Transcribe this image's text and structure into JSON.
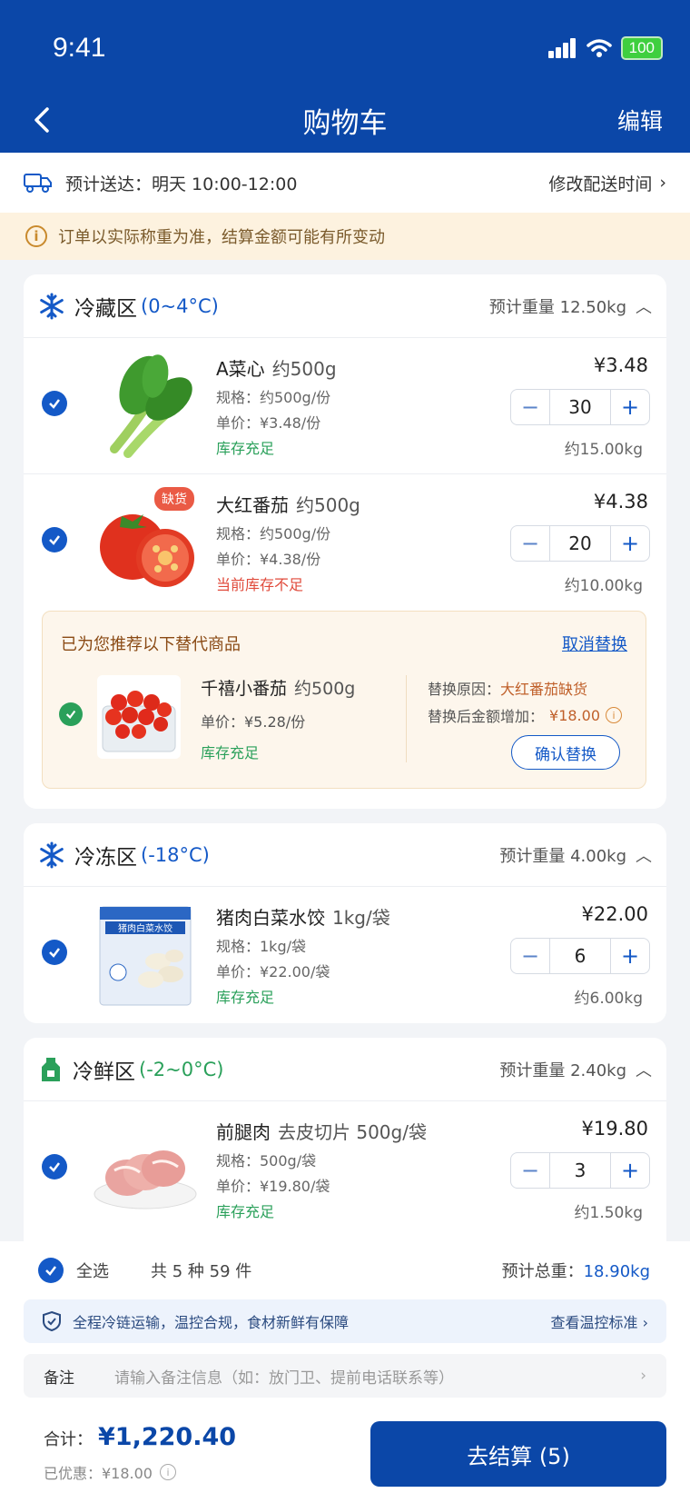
{
  "status": {
    "time": "9:41",
    "battery": "100"
  },
  "nav": {
    "title": "购物车",
    "edit": "编辑"
  },
  "delivery": {
    "text": "预计送达：明天 10:00-12:00",
    "modify": "修改配送时间"
  },
  "notice": "订单以实际称重为准，结算金额可能有所变动",
  "zones": [
    {
      "name": "冷藏区",
      "temp": "(0~4°C)",
      "weight": "预计重量 12.50kg",
      "icon": "snowflake-icon",
      "color": "#1459c7",
      "items": [
        {
          "name": "A菜心",
          "weight": "约500g",
          "spec": "规格：约500g/份",
          "unit": "单价：¥3.48/份",
          "stock": "库存充足",
          "price": "¥3.48",
          "qty": "30",
          "est": "约15.00kg"
        },
        {
          "name": "大红番茄",
          "weight": "约500g",
          "badge": "缺货",
          "spec": "规格：约500g/份",
          "unit": "单价：¥4.38/份",
          "stock": "当前库存不足",
          "price": "¥4.38",
          "qty": "20",
          "est": "约10.00kg"
        }
      ],
      "recommend": {
        "title": "已为您推荐以下替代商品",
        "cancel": "取消替换",
        "name": "千禧小番茄",
        "weight": "约500g",
        "unit": "单价：¥5.28/份",
        "stock": "库存充足",
        "reason_label": "替换原因：",
        "reason": "大红番茄缺货",
        "inc_label": "替换后金额增加：",
        "inc": "¥18.00",
        "confirm": "确认替换"
      }
    },
    {
      "name": "冷冻区",
      "temp": "(-18°C)",
      "weight": "预计重量 4.00kg",
      "icon": "snowflake-icon",
      "color": "#1459c7",
      "items": [
        {
          "name": "猪肉白菜水饺",
          "weight": "1kg/袋",
          "spec": "规格：1kg/袋",
          "unit": "单价：¥22.00/袋",
          "stock": "库存充足",
          "price": "¥22.00",
          "qty": "6",
          "est": "约6.00kg",
          "pack": "猪肉白菜水饺"
        }
      ]
    },
    {
      "name": "冷鲜区",
      "temp": "(-2~0°C)",
      "weight": "预计重量 2.40kg",
      "icon": "bottle-icon",
      "color": "#2aa05a",
      "items": [
        {
          "name": "前腿肉",
          "weight": "去皮切片 500g/袋",
          "spec": "规格：500g/袋",
          "unit": "单价：¥19.80/袋",
          "stock": "库存充足",
          "price": "¥19.80",
          "qty": "3",
          "est": "约1.50kg"
        }
      ]
    }
  ],
  "bottom": {
    "select_all": "全选",
    "count": "共 5 种 59 件",
    "total_weight_label": "预计总重：",
    "total_weight": "18.90kg",
    "cold_chain": "全程冷链运输，温控合规，食材新鲜有保障",
    "cold_more": "查看温控标准",
    "remark_label": "备注",
    "remark_placeholder": "请输入备注信息（如：放门卫、提前电话联系等）",
    "sum_label": "合计：",
    "sum": "¥1,220.40",
    "discount": "已优惠：¥18.00",
    "checkout": "去结算 (5)"
  }
}
